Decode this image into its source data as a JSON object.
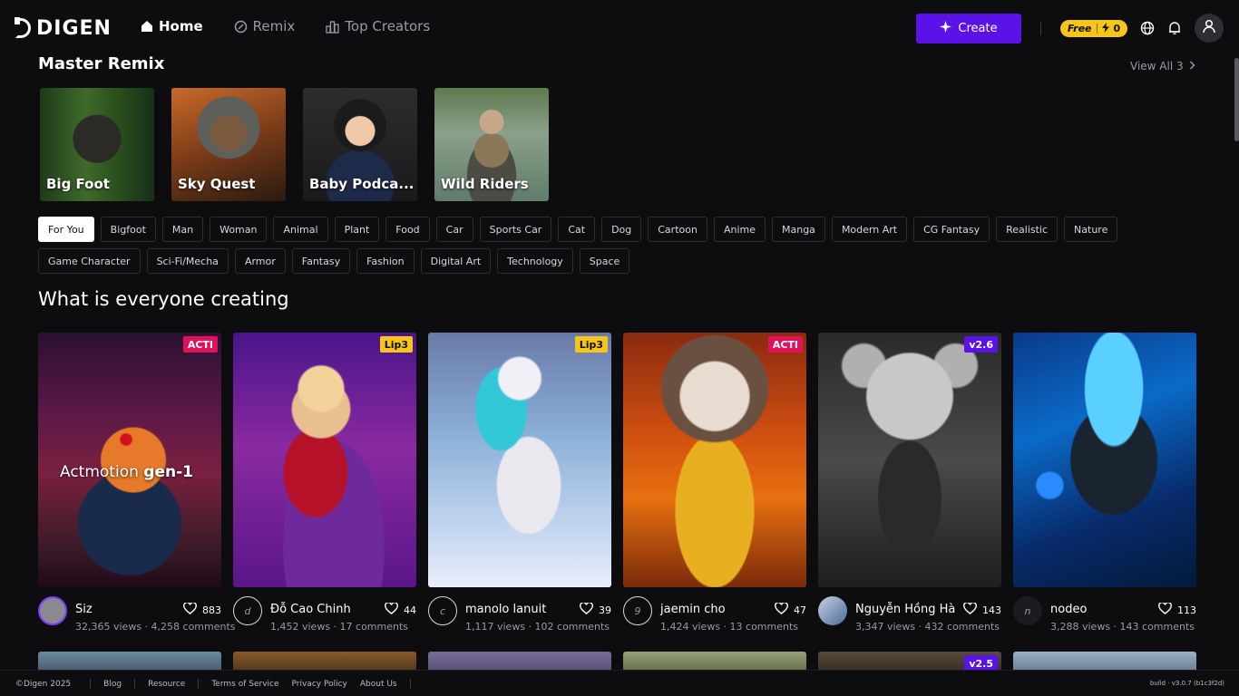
{
  "header": {
    "logo": "DIGEN",
    "nav": [
      {
        "label": "Home",
        "icon": "home-icon",
        "active": true
      },
      {
        "label": "Remix",
        "icon": "remix-icon",
        "active": false
      },
      {
        "label": "Top Creators",
        "icon": "trophy-icon",
        "active": false
      }
    ],
    "create_label": "Create",
    "credit": {
      "plan": "Free",
      "count": "0"
    }
  },
  "master_remix": {
    "title": "Master Remix",
    "view_all": "View All 3",
    "cards": [
      {
        "label": "Big Foot"
      },
      {
        "label": "Sky Quest"
      },
      {
        "label": "Baby Podca..."
      },
      {
        "label": "Wild Riders"
      }
    ]
  },
  "categories_row1": [
    "For You",
    "Bigfoot",
    "Man",
    "Woman",
    "Animal",
    "Plant",
    "Food",
    "Car",
    "Sports Car",
    "Cat",
    "Dog",
    "Cartoon",
    "Anime",
    "Manga",
    "Modern Art",
    "CG Fantasy",
    "Realistic",
    "Nature"
  ],
  "categories_row2": [
    "Game Character",
    "Sci-Fi/Mecha",
    "Armor",
    "Fantasy",
    "Fashion",
    "Digital Art",
    "Technology",
    "Space"
  ],
  "feed": {
    "title": "What is everyone creating",
    "cards": [
      {
        "badge": "ACTI",
        "caption_a": "Actmotion ",
        "caption_b": "gen-1",
        "user": "Siz",
        "avatar": "",
        "likes": "883",
        "stats": "32,365 views · 4,258 comments"
      },
      {
        "badge": "Lip3",
        "user": "Đỗ Cao Chinh",
        "avatar": "d",
        "likes": "44",
        "stats": "1,452 views · 17 comments"
      },
      {
        "badge": "Lip3",
        "user": "manolo lanuit",
        "avatar": "c",
        "likes": "39",
        "stats": "1,117 views · 102 comments"
      },
      {
        "badge": "ACTI",
        "user": "jaemin cho",
        "avatar": "9",
        "likes": "47",
        "stats": "1,424 views · 13 comments"
      },
      {
        "badge": "v2.6",
        "user": "Nguyễn Hồng Hà",
        "avatar": "",
        "likes": "143",
        "stats": "3,347 views · 432 comments"
      },
      {
        "badge": "",
        "user": "nodeo",
        "avatar": "n",
        "likes": "113",
        "stats": "3,288 views · 143 comments"
      }
    ],
    "row2_badge": "v2.5"
  },
  "footer": {
    "copyright": "©Digen 2025",
    "links": [
      "Blog",
      "Resource",
      "Terms of Service",
      "Privacy Policy",
      "About Us"
    ],
    "build": "build · v3.0.7 (b1c3f2d)"
  }
}
